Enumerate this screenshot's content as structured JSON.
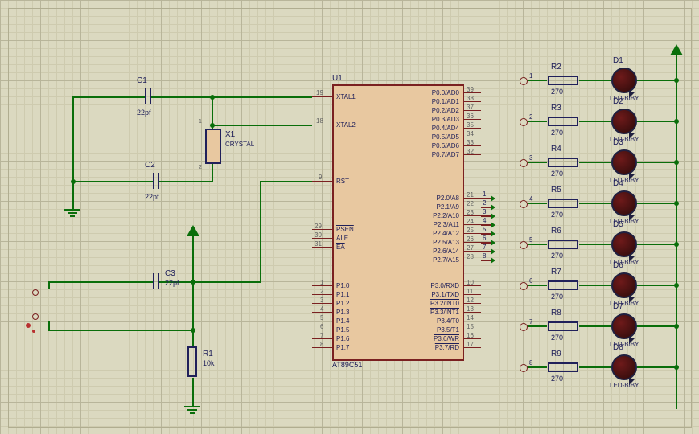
{
  "chip": {
    "ref": "U1",
    "part": "AT89C51",
    "left_pins": [
      {
        "num": "19",
        "name": "XTAL1"
      },
      {
        "num": "18",
        "name": "XTAL2"
      },
      {
        "num": "9",
        "name": "RST"
      },
      {
        "num": "29",
        "name": "PSEN"
      },
      {
        "num": "30",
        "name": "ALE"
      },
      {
        "num": "31",
        "name": "EA"
      },
      {
        "num": "1",
        "name": "P1.0"
      },
      {
        "num": "2",
        "name": "P1.1"
      },
      {
        "num": "3",
        "name": "P1.2"
      },
      {
        "num": "4",
        "name": "P1.3"
      },
      {
        "num": "5",
        "name": "P1.4"
      },
      {
        "num": "6",
        "name": "P1.5"
      },
      {
        "num": "7",
        "name": "P1.6"
      },
      {
        "num": "8",
        "name": "P1.7"
      }
    ],
    "right_pins": [
      {
        "num": "39",
        "name": "P0.0/AD0"
      },
      {
        "num": "38",
        "name": "P0.1/AD1"
      },
      {
        "num": "37",
        "name": "P0.2/AD2"
      },
      {
        "num": "36",
        "name": "P0.3/AD3"
      },
      {
        "num": "35",
        "name": "P0.4/AD4"
      },
      {
        "num": "34",
        "name": "P0.5/AD5"
      },
      {
        "num": "33",
        "name": "P0.6/AD6"
      },
      {
        "num": "32",
        "name": "P0.7/AD7"
      },
      {
        "num": "21",
        "name": "P2.0/A8"
      },
      {
        "num": "22",
        "name": "P2.1/A9"
      },
      {
        "num": "23",
        "name": "P2.2/A10"
      },
      {
        "num": "24",
        "name": "P2.3/A11"
      },
      {
        "num": "25",
        "name": "P2.4/A12"
      },
      {
        "num": "26",
        "name": "P2.5/A13"
      },
      {
        "num": "27",
        "name": "P2.6/A14"
      },
      {
        "num": "28",
        "name": "P2.7/A15"
      },
      {
        "num": "10",
        "name": "P3.0/RXD"
      },
      {
        "num": "11",
        "name": "P3.1/TXD"
      },
      {
        "num": "12",
        "name": "P3.2/INT0"
      },
      {
        "num": "13",
        "name": "P3.3/INT1"
      },
      {
        "num": "14",
        "name": "P3.4/T0"
      },
      {
        "num": "15",
        "name": "P3.5/T1"
      },
      {
        "num": "16",
        "name": "P3.6/WR"
      },
      {
        "num": "17",
        "name": "P3.7/RD"
      }
    ]
  },
  "c1": {
    "ref": "C1",
    "val": "22pf"
  },
  "c2": {
    "ref": "C2",
    "val": "22pf"
  },
  "c3": {
    "ref": "C3",
    "val": "22pf"
  },
  "r1": {
    "ref": "R1",
    "val": "10k"
  },
  "x1": {
    "ref": "X1",
    "val": "CRYSTAL"
  },
  "led_rows": [
    {
      "r_ref": "R2",
      "r_val": "270",
      "d_ref": "D1",
      "d_val": "LED-BIBY",
      "net": "1"
    },
    {
      "r_ref": "R3",
      "r_val": "270",
      "d_ref": "D2",
      "d_val": "LED-BIBY",
      "net": "2"
    },
    {
      "r_ref": "R4",
      "r_val": "270",
      "d_ref": "D3",
      "d_val": "LED-BIBY",
      "net": "3"
    },
    {
      "r_ref": "R5",
      "r_val": "270",
      "d_ref": "D4",
      "d_val": "LED-BIBY",
      "net": "4"
    },
    {
      "r_ref": "R6",
      "r_val": "270",
      "d_ref": "D5",
      "d_val": "LED-BIBY",
      "net": "5"
    },
    {
      "r_ref": "R7",
      "r_val": "270",
      "d_ref": "D6",
      "d_val": "LED-BIBY",
      "net": "6"
    },
    {
      "r_ref": "R8",
      "r_val": "270",
      "d_ref": "D7",
      "d_val": "LED-BIBY",
      "net": "7"
    },
    {
      "r_ref": "R9",
      "r_val": "270",
      "d_ref": "D8",
      "d_val": "LED-BIBY",
      "net": "8"
    }
  ],
  "p2_nets": [
    "1",
    "2",
    "3",
    "4",
    "5",
    "6",
    "7",
    "8"
  ]
}
